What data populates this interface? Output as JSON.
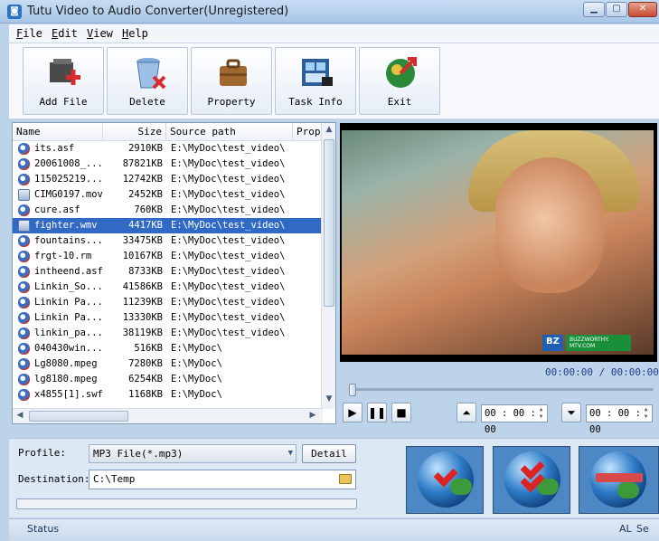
{
  "window": {
    "title": "Tutu Video to Audio Converter(Unregistered)"
  },
  "menu": [
    {
      "key": "F",
      "rest": "ile"
    },
    {
      "key": "E",
      "rest": "dit"
    },
    {
      "key": "V",
      "rest": "iew"
    },
    {
      "key": "H",
      "rest": "elp"
    }
  ],
  "toolbar": {
    "add_file": "Add File",
    "delete": "Delete",
    "property": "Property",
    "task_info": "Task Info",
    "exit": "Exit"
  },
  "list": {
    "headers": {
      "name": "Name",
      "size": "Size",
      "path": "Source path",
      "prop": "Prop"
    },
    "rows": [
      {
        "name": "its.asf",
        "size": "2910KB",
        "path": "E:\\MyDoc\\test_video\\"
      },
      {
        "name": "20061008_...",
        "size": "87821KB",
        "path": "E:\\MyDoc\\test_video\\"
      },
      {
        "name": "115025219...",
        "size": "12742KB",
        "path": "E:\\MyDoc\\test_video\\"
      },
      {
        "name": "CIMG0197.mov",
        "size": "2452KB",
        "path": "E:\\MyDoc\\test_video\\"
      },
      {
        "name": "cure.asf",
        "size": "760KB",
        "path": "E:\\MyDoc\\test_video\\"
      },
      {
        "name": "fighter.wmv",
        "size": "4417KB",
        "path": "E:\\MyDoc\\test_video\\",
        "selected": true
      },
      {
        "name": "fountains...",
        "size": "33475KB",
        "path": "E:\\MyDoc\\test_video\\"
      },
      {
        "name": "frgt-10.rm",
        "size": "10167KB",
        "path": "E:\\MyDoc\\test_video\\"
      },
      {
        "name": "intheend.asf",
        "size": "8733KB",
        "path": "E:\\MyDoc\\test_video\\"
      },
      {
        "name": "Linkin_So...",
        "size": "41586KB",
        "path": "E:\\MyDoc\\test_video\\"
      },
      {
        "name": "Linkin Pa...",
        "size": "11239KB",
        "path": "E:\\MyDoc\\test_video\\"
      },
      {
        "name": "Linkin Pa...",
        "size": "13330KB",
        "path": "E:\\MyDoc\\test_video\\"
      },
      {
        "name": "linkin_pa...",
        "size": "38119KB",
        "path": "E:\\MyDoc\\test_video\\"
      },
      {
        "name": "040430win...",
        "size": "516KB",
        "path": "E:\\MyDoc\\"
      },
      {
        "name": "Lg8080.mpeg",
        "size": "7280KB",
        "path": "E:\\MyDoc\\"
      },
      {
        "name": "lg8180.mpeg",
        "size": "6254KB",
        "path": "E:\\MyDoc\\"
      },
      {
        "name": "x4855[1].swf",
        "size": "1168KB",
        "path": "E:\\MyDoc\\"
      }
    ]
  },
  "preview": {
    "watermark_left": "BZ",
    "watermark_right": "BUZZWORTHY. MTV.COM"
  },
  "player": {
    "time_display": "00:00:00 / 00:00:00",
    "start_time": "00 : 00 : 00",
    "end_time": "00 : 00 : 00",
    "seek_position": 0
  },
  "settings": {
    "profile_label": "Profile:",
    "profile_value": "MP3 File(*.mp3)",
    "detail_label": "Detail",
    "destination_label": "Destination:",
    "destination_value": "C:\\Temp",
    "progress": 0
  },
  "statusbar": {
    "status": "Status",
    "right1": "AL",
    "right2": "Se"
  }
}
